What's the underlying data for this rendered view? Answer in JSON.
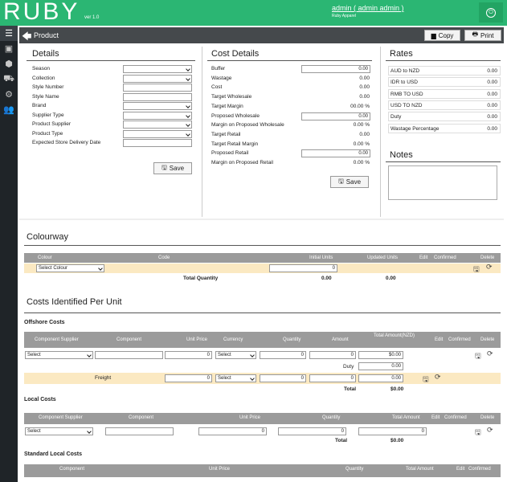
{
  "app": {
    "logo": "RUBY",
    "version": "ver 1.0",
    "user": "admin ( admin admin )",
    "company": "Ruby Apparel"
  },
  "page": {
    "title": "Product",
    "copy": "Copy",
    "print": "Print"
  },
  "details": {
    "title": "Details",
    "labels": [
      "Season",
      "Collection",
      "Style Number",
      "Style Name",
      "Brand",
      "Supplier Type",
      "Product Supplier",
      "Product Type",
      "Expected Store Delivery Date"
    ],
    "save": "Save"
  },
  "cost": {
    "title": "Cost Details",
    "rows": [
      {
        "label": "Buffer",
        "value": "0.00",
        "input": true
      },
      {
        "label": "Wastage",
        "value": "0.00"
      },
      {
        "label": "Cost",
        "value": "0.00"
      },
      {
        "label": "Target Wholesale",
        "value": "0.00"
      },
      {
        "label": "Target Margin",
        "value": "00.00 %"
      },
      {
        "label": "Proposed Wholesale",
        "value": "0.00",
        "input": true
      },
      {
        "label": "Margin on Proposed Wholesale",
        "value": "0.00 %"
      },
      {
        "label": "Target Retail",
        "value": "0.00"
      },
      {
        "label": "Target Retail Margin",
        "value": "0.00 %"
      },
      {
        "label": "Proposed Retail",
        "value": "0.00",
        "input": true
      },
      {
        "label": "Margin on Proposed Retail",
        "value": "0.00 %"
      }
    ],
    "save": "Save"
  },
  "rates": {
    "title": "Rates",
    "rows": [
      {
        "label": "AUD to NZD",
        "value": "0.00"
      },
      {
        "label": "IDR to USD",
        "value": "0.00"
      },
      {
        "label": "RMB TO USD",
        "value": "0.00"
      },
      {
        "label": "USD TO NZD",
        "value": "0.00"
      },
      {
        "label": "Duty",
        "value": "0.00"
      },
      {
        "label": "Wastage Percentage",
        "value": "0.00"
      }
    ]
  },
  "notes": {
    "title": "Notes"
  },
  "colourway": {
    "title": "Colourway",
    "headers": [
      "Colour",
      "Code",
      "Initial Units",
      "Updated Units",
      "Edit",
      "Confirmed",
      "Delete"
    ],
    "select": "Select Colour",
    "qty": "0",
    "total_label": "Total Quantity",
    "total_initial": "0.00",
    "total_updated": "0.00"
  },
  "costs": {
    "title": "Costs Identified Per Unit"
  },
  "offshore": {
    "title": "Offshore Costs",
    "headers": [
      "Component Supplier",
      "Component",
      "Unit Price",
      "Currency",
      "Quantity",
      "Amount",
      "Total Amount(NZD)",
      "Edit",
      "Confirmed",
      "Delete"
    ],
    "select": "Select",
    "unit": "0",
    "currency": "Select",
    "qty": "0",
    "amount": "0",
    "total": "$0.00",
    "duty_label": "Duty",
    "duty": "0.00",
    "freight": "Freight",
    "f_unit": "0",
    "f_currency": "Select",
    "f_qty": "0",
    "f_amount": "0",
    "f_total": "0.00",
    "total_label": "Total"
  },
  "local": {
    "title": "Local Costs",
    "headers": [
      "Component Supplier",
      "Component",
      "Unit Price",
      "Quantity",
      "Total Amount",
      "Edit",
      "Confirmed",
      "Delete"
    ],
    "select": "Select",
    "unit": "0",
    "qty": "0",
    "total_amount": "0",
    "total_label": "Total",
    "total": "$0.00"
  },
  "standard": {
    "title": "Standard Local Costs",
    "headers": [
      "Component",
      "Unit Price",
      "Quantity",
      "Total Amount",
      "Edit",
      "Confirmed"
    ]
  }
}
